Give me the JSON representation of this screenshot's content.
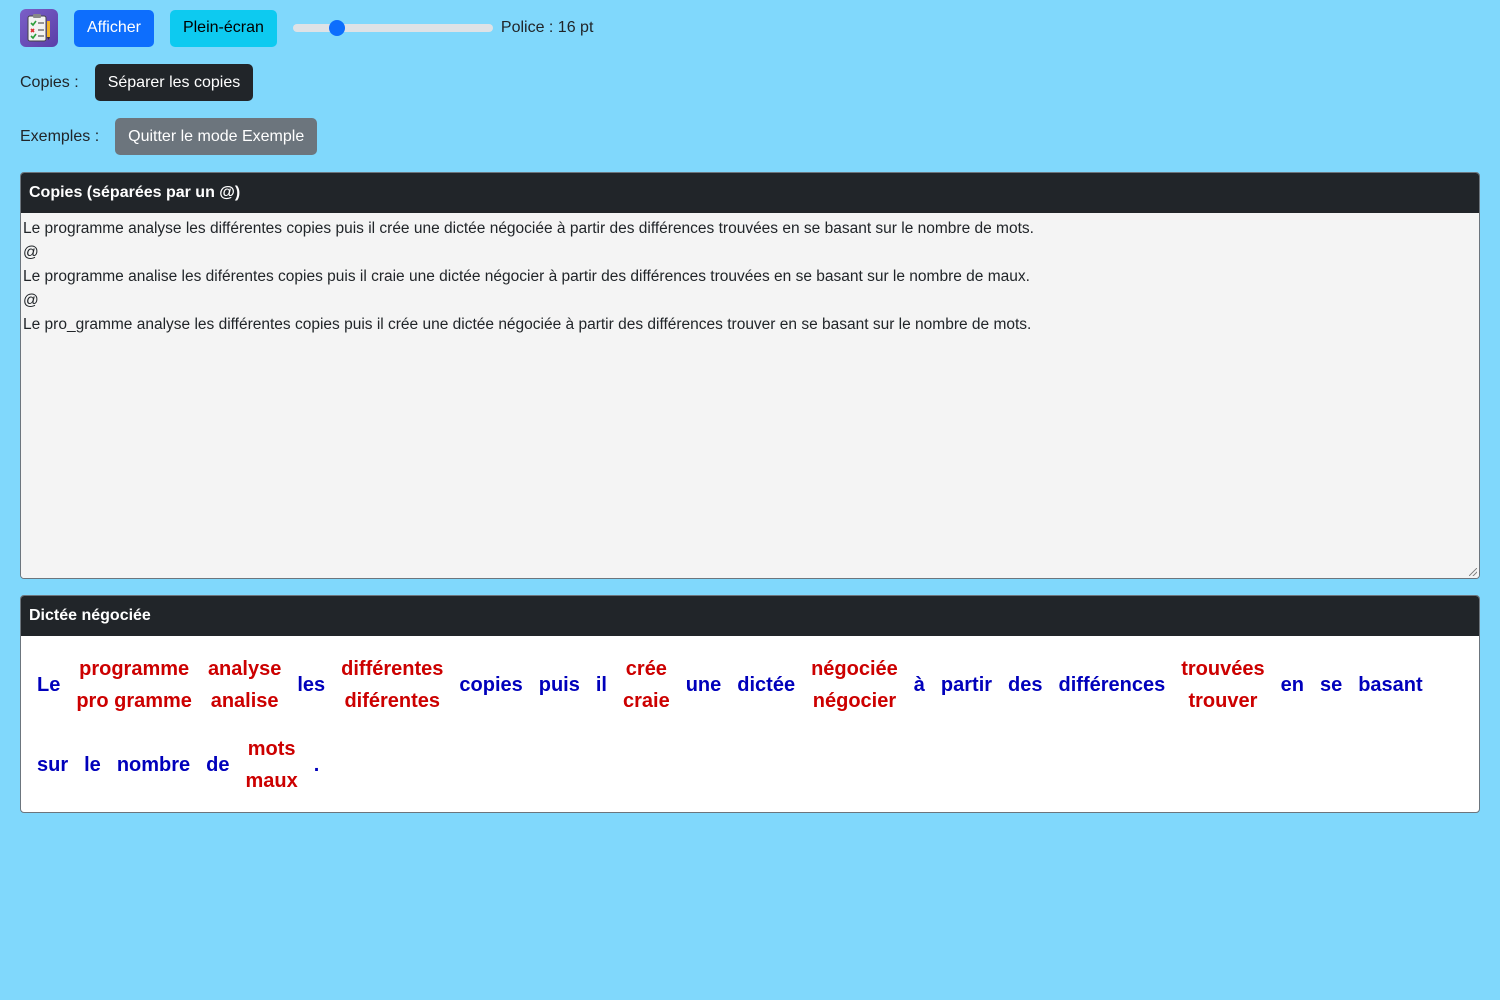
{
  "toolbar": {
    "afficher_label": "Afficher",
    "plein_ecran_label": "Plein-écran",
    "font_slider_value": 0.22,
    "font_label": "Police : 16 pt"
  },
  "copies_row": {
    "label": "Copies :",
    "button_label": "Séparer les copies"
  },
  "exemples_row": {
    "label": "Exemples :",
    "button_label": "Quitter le mode Exemple"
  },
  "copies_panel": {
    "title": "Copies (séparées par un @)",
    "text": "Le programme analyse les différentes copies puis il crée une dictée négociée à partir des différences trouvées en se basant sur le nombre de mots.\n@\nLe programme analise les diférentes copies puis il craie une dictée négocier à partir des différences trouvées en se basant sur le nombre de maux.\n@\nLe pro_gramme analyse les différentes copies puis il crée une dictée négociée à partir des différences trouver en se basant sur le nombre de mots."
  },
  "dictee_panel": {
    "title": "Dictée négociée",
    "colors": {
      "same": "#0000bb",
      "diff": "#cc0000"
    },
    "words": [
      {
        "v": [
          "Le"
        ]
      },
      {
        "v": [
          "programme",
          "pro gramme"
        ]
      },
      {
        "v": [
          "analyse",
          "analise"
        ]
      },
      {
        "v": [
          "les"
        ]
      },
      {
        "v": [
          "différentes",
          "diférentes"
        ]
      },
      {
        "v": [
          "copies"
        ]
      },
      {
        "v": [
          "puis"
        ]
      },
      {
        "v": [
          "il"
        ]
      },
      {
        "v": [
          "crée",
          "craie"
        ]
      },
      {
        "v": [
          "une"
        ]
      },
      {
        "v": [
          "dictée"
        ]
      },
      {
        "v": [
          "négociée",
          "négocier"
        ]
      },
      {
        "v": [
          "à"
        ]
      },
      {
        "v": [
          "partir"
        ]
      },
      {
        "v": [
          "des"
        ]
      },
      {
        "v": [
          "différences"
        ]
      },
      {
        "v": [
          "trouvées",
          "trouver"
        ]
      },
      {
        "v": [
          "en"
        ]
      },
      {
        "v": [
          "se"
        ]
      },
      {
        "v": [
          "basant"
        ]
      },
      {
        "v": [
          "sur"
        ]
      },
      {
        "v": [
          "le"
        ]
      },
      {
        "v": [
          "nombre"
        ]
      },
      {
        "v": [
          "de"
        ]
      },
      {
        "v": [
          "mots",
          "maux"
        ]
      },
      {
        "v": [
          "."
        ]
      }
    ]
  }
}
